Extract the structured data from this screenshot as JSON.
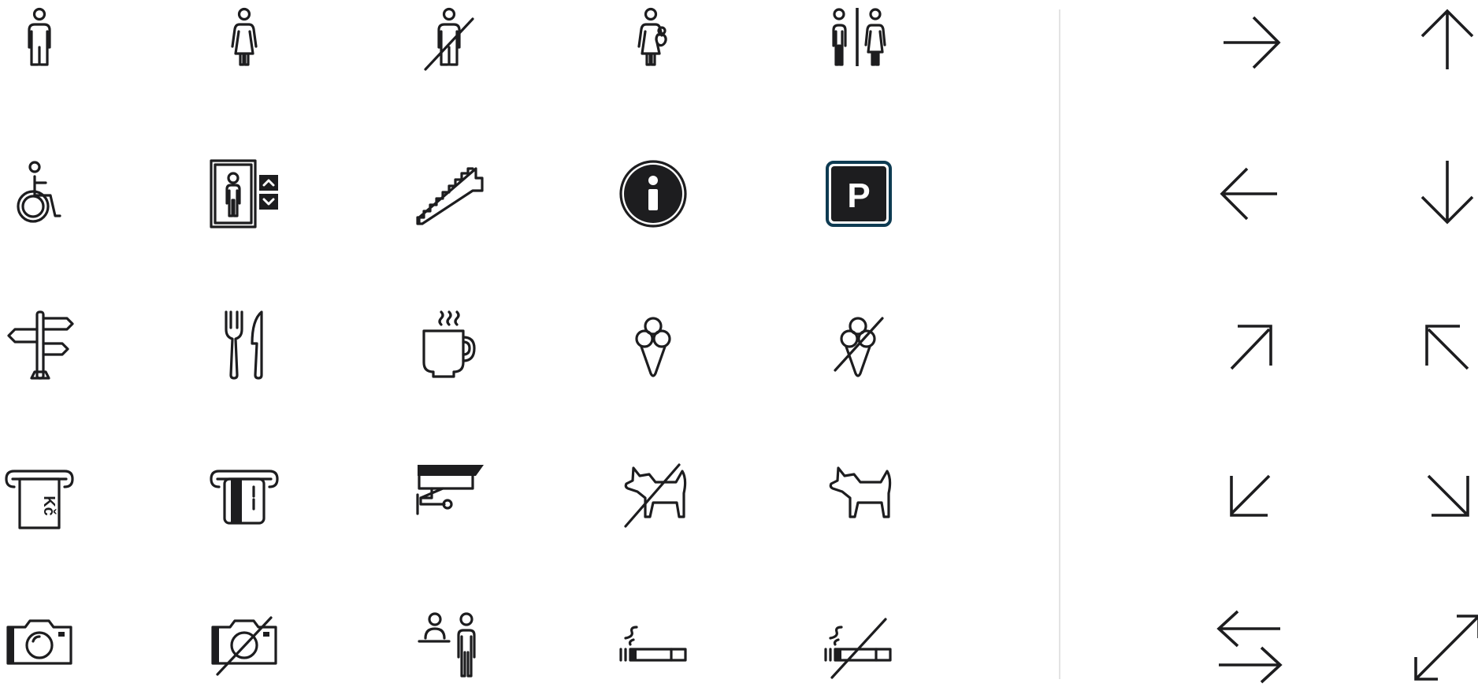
{
  "colors": {
    "ink": "#1d1d1f",
    "background": "#ffffff",
    "divider": "#e3e3e3",
    "parking_border": "#0e3b52"
  },
  "icons": [
    [
      "man-icon",
      "woman-icon",
      "no-men-icon",
      "mother-with-baby-icon",
      "toilets-icon"
    ],
    [
      "wheelchair-icon",
      "elevator-icon",
      "stairs-icon",
      "information-icon",
      "parking-icon"
    ],
    [
      "signpost-icon",
      "restaurant-icon",
      "coffee-icon",
      "ice-cream-icon",
      "no-ice-cream-icon"
    ],
    [
      "cash-atm-icon",
      "card-atm-icon",
      "cctv-camera-icon",
      "no-dogs-icon",
      "dogs-allowed-icon"
    ],
    [
      "camera-icon",
      "no-photography-icon",
      "reception-icon",
      "smoking-icon",
      "no-smoking-icon"
    ]
  ],
  "arrows": [
    [
      "arrow-right-icon",
      "arrow-up-icon"
    ],
    [
      "arrow-left-icon",
      "arrow-down-icon"
    ],
    [
      "arrow-up-right-icon",
      "arrow-up-left-icon"
    ],
    [
      "arrow-down-left-icon",
      "arrow-down-right-icon"
    ],
    [
      "arrows-left-right-icon",
      "expand-diagonal-icon"
    ]
  ],
  "labels": {
    "atm_currency": "Kč",
    "parking_letter": "P"
  }
}
